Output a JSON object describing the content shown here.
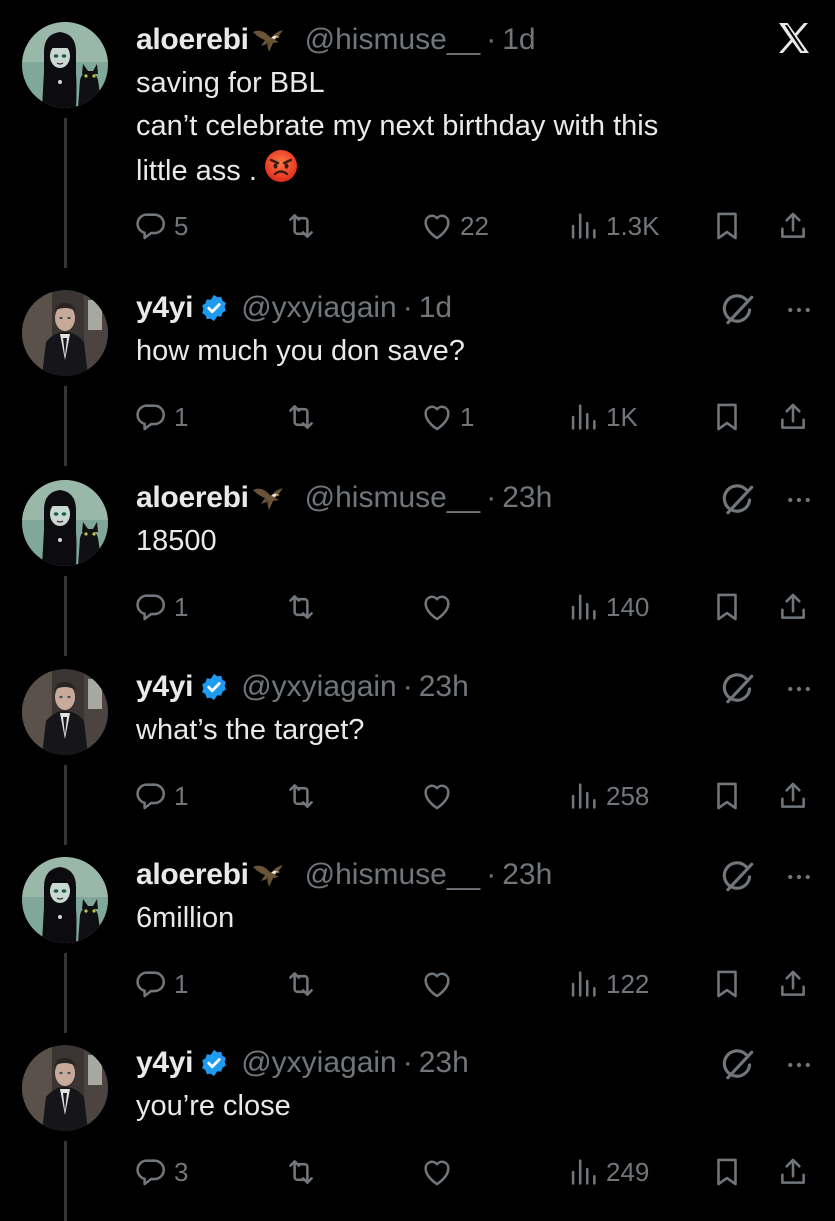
{
  "tweets": [
    {
      "name": "aloerebi",
      "name_emoji": "eagle",
      "handle": "@hismuse__",
      "time": "1d",
      "verified": false,
      "lines": [
        "saving for BBL",
        "can’t celebrate my next birthday with this",
        "little ass ."
      ],
      "trailing_emoji": "angry-face",
      "replies": "5",
      "retweets": "",
      "likes": "22",
      "views": "1.3K",
      "corner": "x-logo"
    },
    {
      "name": "y4yi",
      "handle": "@yxyiagain",
      "time": "1d",
      "verified": true,
      "lines": [
        "how much you don save?"
      ],
      "replies": "1",
      "retweets": "",
      "likes": "1",
      "views": "1K",
      "corner": "grok-and-more"
    },
    {
      "name": "aloerebi",
      "name_emoji": "eagle",
      "handle": "@hismuse__",
      "time": "23h",
      "verified": false,
      "lines": [
        "18500"
      ],
      "replies": "1",
      "retweets": "",
      "likes": "",
      "views": "140",
      "corner": "grok-and-more"
    },
    {
      "name": "y4yi",
      "handle": "@yxyiagain",
      "time": "23h",
      "verified": true,
      "lines": [
        "what’s the target?"
      ],
      "replies": "1",
      "retweets": "",
      "likes": "",
      "views": "258",
      "corner": "grok-and-more"
    },
    {
      "name": "aloerebi",
      "name_emoji": "eagle",
      "handle": "@hismuse__",
      "time": "23h",
      "verified": false,
      "lines": [
        "6million"
      ],
      "replies": "1",
      "retweets": "",
      "likes": "",
      "views": "122",
      "corner": "grok-and-more"
    },
    {
      "name": "y4yi",
      "handle": "@yxyiagain",
      "time": "23h",
      "verified": true,
      "lines": [
        "you’re close"
      ],
      "replies": "3",
      "retweets": "",
      "likes": "",
      "views": "249",
      "corner": "grok-and-more"
    }
  ],
  "colors": {
    "background": "#000000",
    "text": "#e7e9ea",
    "muted": "#71767b",
    "verified": "#1d9bf0",
    "thread_line": "#333639"
  },
  "icons": {
    "reply": "reply-icon",
    "retweet": "retweet-icon",
    "like": "like-icon",
    "views": "views-icon",
    "bookmark": "bookmark-icon",
    "share": "share-icon",
    "grok": "grok-icon",
    "more": "more-icon",
    "logo": "x-logo-icon"
  },
  "dot": "·"
}
